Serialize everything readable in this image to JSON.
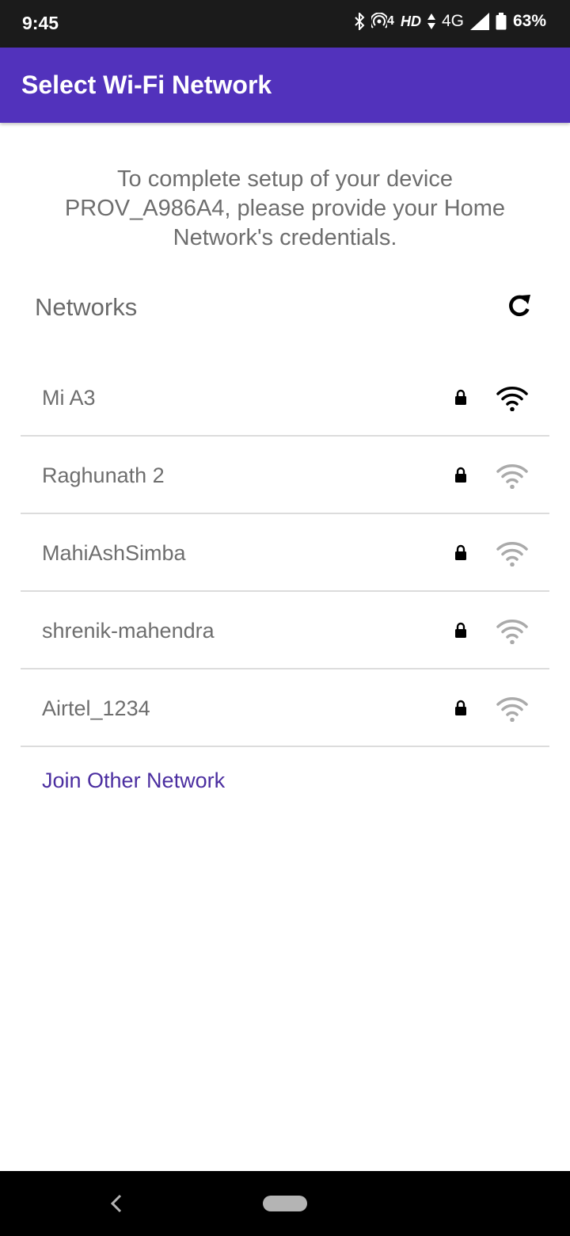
{
  "status_bar": {
    "time": "9:45",
    "network_badge": "4",
    "hd_label": "HD",
    "network_type": "4G",
    "battery_percent": "63%",
    "icons": [
      "bluetooth-icon",
      "hotspot-icon",
      "data-arrows-icon",
      "cell-signal-icon",
      "battery-icon"
    ]
  },
  "app_bar": {
    "title": "Select Wi-Fi Network",
    "background_color": "#5232bc"
  },
  "intro_text": "To complete setup of your device PROV_A986A4, please provide your Home Network's credentials.",
  "networks_section": {
    "title": "Networks",
    "refresh_icon": "refresh-icon"
  },
  "networks": [
    {
      "name": "Mi A3",
      "secured": true,
      "signal_level": 4,
      "signal_color": "#000000"
    },
    {
      "name": "Raghunath 2",
      "secured": true,
      "signal_level": 1,
      "signal_color": "#aaaaaa"
    },
    {
      "name": "MahiAshSimba",
      "secured": true,
      "signal_level": 1,
      "signal_color": "#aaaaaa"
    },
    {
      "name": "shrenik-mahendra",
      "secured": true,
      "signal_level": 1,
      "signal_color": "#aaaaaa"
    },
    {
      "name": "Airtel_1234",
      "secured": true,
      "signal_level": 1,
      "signal_color": "#aaaaaa"
    }
  ],
  "join_other_label": "Join Other Network",
  "accent_color": "#4b2ea0"
}
